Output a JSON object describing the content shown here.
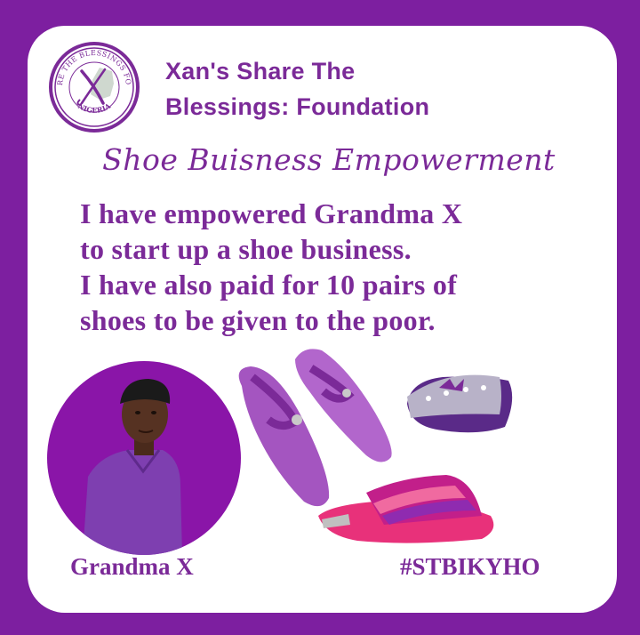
{
  "org": {
    "name_line1": "Xan's Share The",
    "name_line2": "Blessings: Foundation",
    "logo_text": "XAN'S SHARE THE BLESSINGS FOUNDATION",
    "logo_country": "NIGERIA"
  },
  "headline": "Shoe Buisness Empowerment",
  "message": {
    "lines": [
      "I have empowered Grandma X",
      "to start up a shoe business.",
      "I have also paid for 10 pairs of",
      "shoes to be given to the poor."
    ]
  },
  "portrait": {
    "caption": "Grandma X"
  },
  "hashtag": "#STBIKYHO",
  "colors": {
    "border": "#7d1fa0",
    "text": "#7b2a98",
    "portrait_bg": "#8a15a8",
    "sandal_purple": "#a455c0",
    "sandal_pink": "#e8317a"
  }
}
